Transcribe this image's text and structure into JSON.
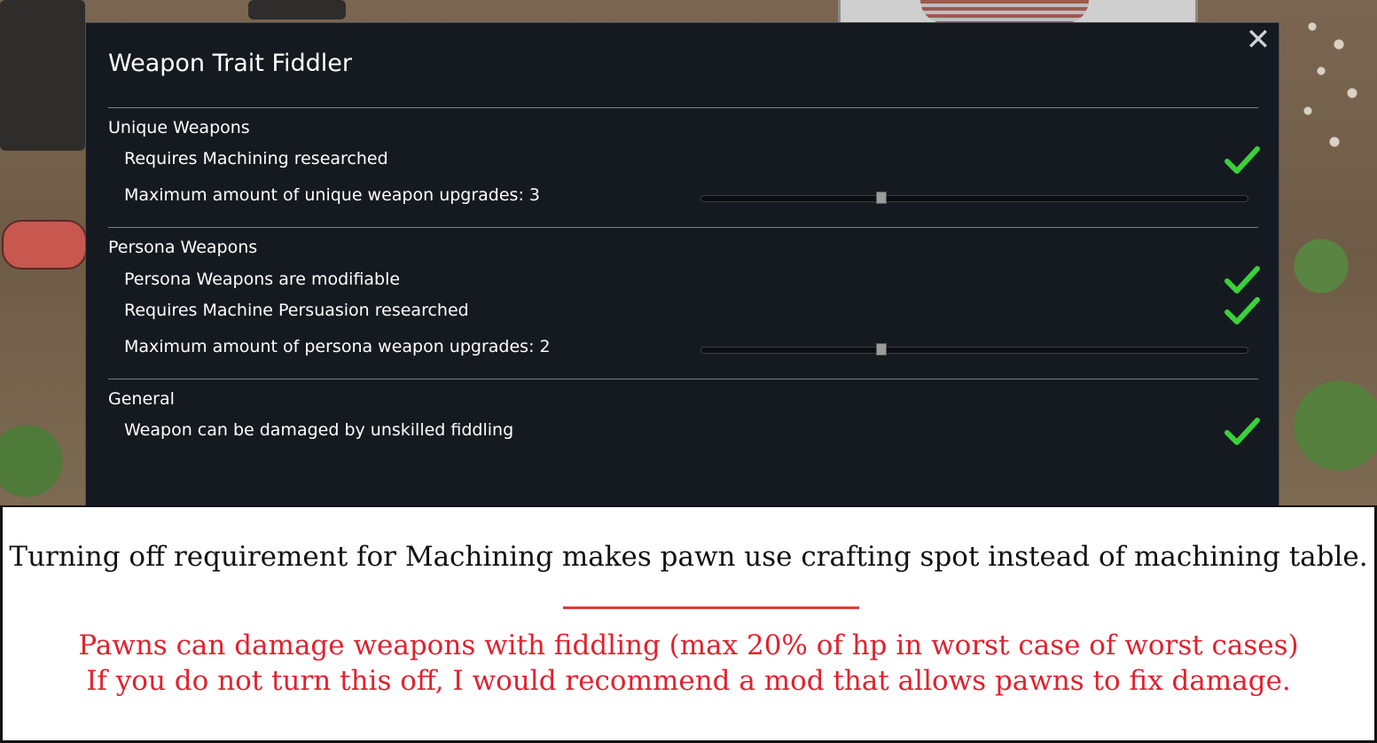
{
  "dialog": {
    "title": "Weapon Trait Fiddler",
    "close_icon": "close-icon",
    "sections": [
      {
        "heading": "Unique Weapons",
        "options": [
          {
            "label": "Requires Machining researched",
            "type": "checkbox",
            "checked": true
          },
          {
            "label": "Maximum amount of unique weapon upgrades: 3",
            "type": "slider",
            "fraction": 0.33
          }
        ]
      },
      {
        "heading": "Persona Weapons",
        "options": [
          {
            "label": "Persona Weapons are modifiable",
            "type": "checkbox",
            "checked": true
          },
          {
            "label": "Requires Machine Persuasion researched",
            "type": "checkbox",
            "checked": true
          },
          {
            "label": "Maximum amount of persona weapon upgrades: 2",
            "type": "slider",
            "fraction": 0.33
          }
        ]
      },
      {
        "heading": "General",
        "options": [
          {
            "label": "Weapon can be damaged by unskilled fiddling",
            "type": "checkbox",
            "checked": true
          }
        ]
      }
    ],
    "check_color": "#3ad13a"
  },
  "caption": {
    "main": "Turning off requirement for Machining makes pawn use crafting spot instead of machining table.",
    "warning_line1": "Pawns can damage weapons with fiddling (max 20% of hp in worst case of worst cases)",
    "warning_line2": "If you do not turn this off, I would recommend a mod that allows pawns to fix damage.",
    "warning_color": "#e0222f"
  }
}
